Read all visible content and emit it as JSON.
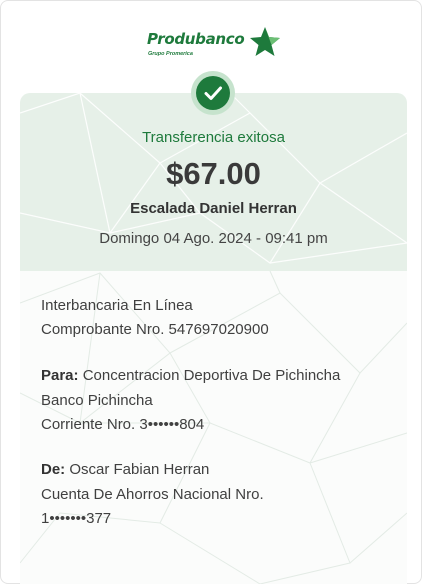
{
  "brand": {
    "name": "Produbanco",
    "subtitle": "Grupo Promerica",
    "color": "#1e7a3c"
  },
  "status": {
    "icon": "checkmark-icon",
    "text": "Transferencia exitosa"
  },
  "amount": "$67.00",
  "beneficiary_name": "Escalada Daniel Herran",
  "datetime": "Domingo 04 Ago. 2024 - 09:41 pm",
  "details": {
    "type": "Interbancaria En Línea",
    "receipt": "Comprobante Nro. 547697020900",
    "to_label": "Para:",
    "to_name": "Concentracion Deportiva De Pichincha",
    "to_bank": "Banco Pichincha",
    "to_account": "Corriente Nro. 3••••••804",
    "from_label": "De:",
    "from_name": "Oscar Fabian Herran",
    "from_account_type": "Cuenta De Ahorros Nacional Nro.",
    "from_account": "1•••••••377"
  }
}
